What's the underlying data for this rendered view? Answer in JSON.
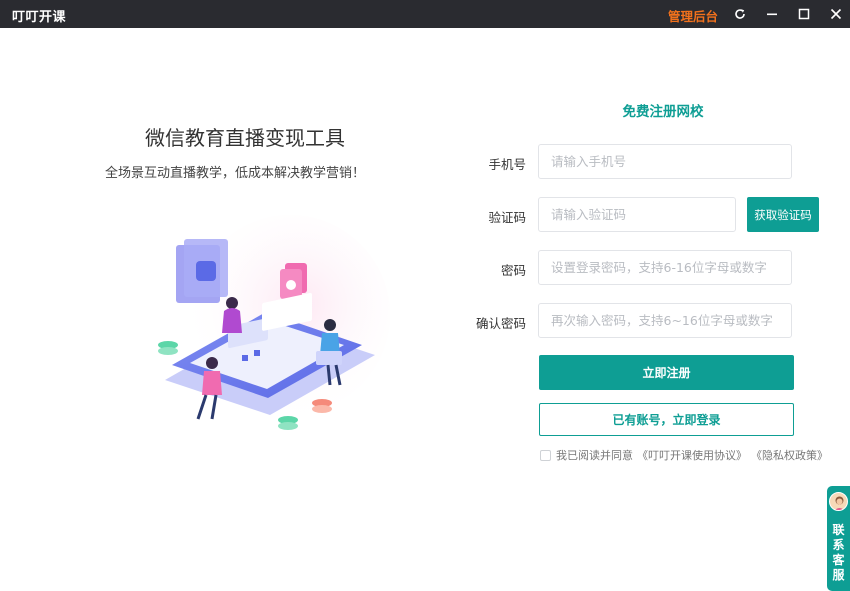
{
  "window": {
    "title": "叮叮开课",
    "admin_link": "管理后台",
    "controls": [
      "refresh-icon",
      "minimize-icon",
      "maximize-icon",
      "close-icon"
    ]
  },
  "hero": {
    "title": "微信教育直播变现工具",
    "subtitle": "全场景互动直播教学，低成本解决教学营销！"
  },
  "form": {
    "title": "免费注册网校",
    "phone": {
      "label": "手机号",
      "value": "",
      "placeholder": "请输入手机号"
    },
    "code": {
      "label": "验证码",
      "value": "",
      "placeholder": "请输入验证码",
      "button": "获取验证码"
    },
    "password": {
      "label": "密码",
      "value": "",
      "placeholder": "设置登录密码，支持6-16位字母或数字"
    },
    "confirm": {
      "label": "确认密码",
      "value": "",
      "placeholder": "再次输入密码，支持6~16位字母或数字"
    },
    "register_button": "立即注册",
    "login_button": "已有账号，立即登录",
    "agreement": {
      "checked": false,
      "text": "我已阅读并同意",
      "terms_link": "《叮叮开课使用协议》",
      "privacy_link": "《隐私权政策》"
    }
  },
  "customer_service": {
    "chars": [
      "联",
      "系",
      "客",
      "服"
    ]
  },
  "colors": {
    "titlebar": "#2a2b30",
    "accent": "#0e9e94",
    "admin_link": "#f2711c"
  }
}
